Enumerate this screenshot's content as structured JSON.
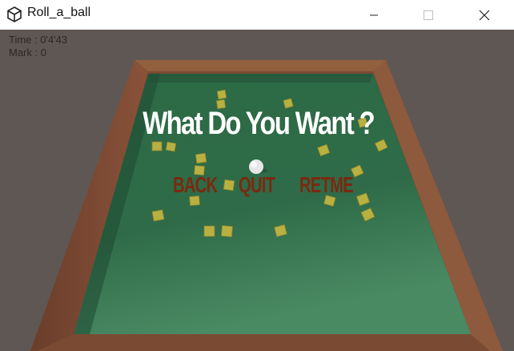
{
  "window": {
    "title": "Roll_a_ball"
  },
  "hud": {
    "time": "Time : 0'4'43",
    "mark": "Mark : 0"
  },
  "dialog": {
    "question": "What Do You Want ?",
    "buttons": {
      "back": "BACK",
      "quit": "QUIT",
      "retme": "RETME"
    }
  },
  "colors": {
    "ground": "#5f5754",
    "wall": "#7a4a34",
    "floor": "#2f6b47",
    "cube": "#b8b040",
    "button_text": "#7a2a10"
  }
}
